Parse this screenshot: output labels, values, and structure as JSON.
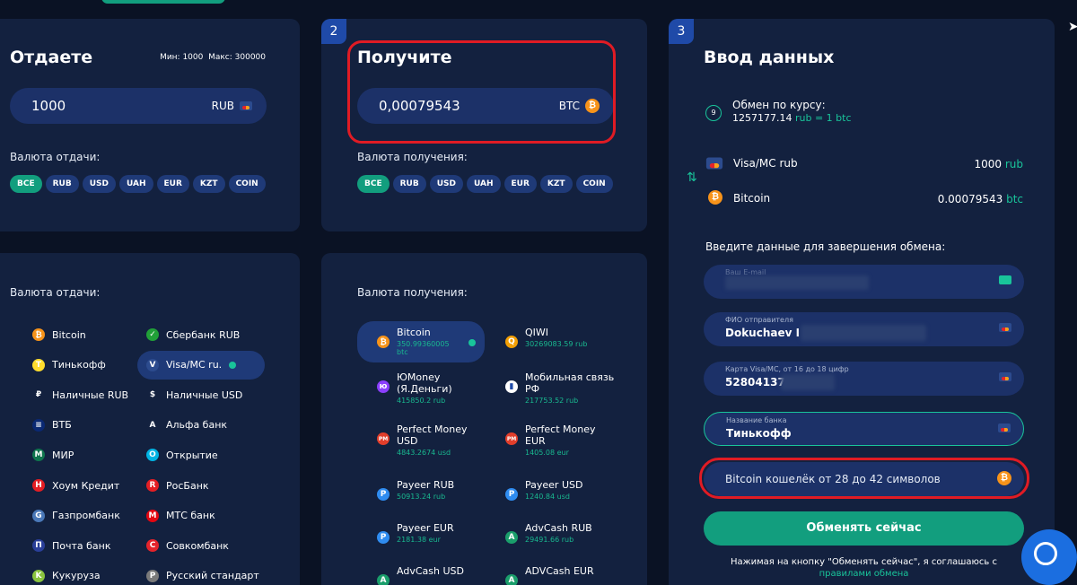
{
  "give": {
    "title": "Отдаете",
    "limits": "Мин: 1000  Макс: 300000",
    "amount": "1000",
    "currency": "RUB",
    "chips_label": "Валюта отдачи:",
    "chips": [
      "ВСЕ",
      "RUB",
      "USD",
      "UAH",
      "EUR",
      "KZT",
      "COIN"
    ],
    "list_label": "Валюта отдачи:",
    "list": [
      {
        "name": "Bitcoin",
        "color": "#f7931a",
        "glyph": "₿"
      },
      {
        "name": "Сбербанк RUB",
        "color": "#21a038",
        "glyph": "✓"
      },
      {
        "name": "Тинькофф",
        "color": "#ffdd2d",
        "glyph": "T"
      },
      {
        "name": "Visa/MC ru.",
        "color": "#2c4b8e",
        "glyph": "V"
      },
      {
        "name": "Наличные RUB",
        "color": "transparent",
        "glyph": "₽"
      },
      {
        "name": "Наличные USD",
        "color": "transparent",
        "glyph": "$"
      },
      {
        "name": "ВТБ",
        "color": "#0a2973",
        "glyph": "≡"
      },
      {
        "name": "Альфа банк",
        "color": "transparent",
        "glyph": "A"
      },
      {
        "name": "МИР",
        "color": "#0f754e",
        "glyph": "M"
      },
      {
        "name": "Открытие",
        "color": "#00b3e3",
        "glyph": "O"
      },
      {
        "name": "Хоум Кредит",
        "color": "#e31e24",
        "glyph": "H"
      },
      {
        "name": "РосБанк",
        "color": "#e31e24",
        "glyph": "R"
      },
      {
        "name": "Газпромбанк",
        "color": "#4a78b8",
        "glyph": "G"
      },
      {
        "name": "МТС банк",
        "color": "#e30611",
        "glyph": "M"
      },
      {
        "name": "Почта банк",
        "color": "#2a3f99",
        "glyph": "П"
      },
      {
        "name": "Совкомбанк",
        "color": "#e4232b",
        "glyph": "C"
      },
      {
        "name": "Кукуруза",
        "color": "#8ac43f",
        "glyph": "K"
      },
      {
        "name": "Русский стандарт",
        "color": "#7a7a7a",
        "glyph": "Р"
      }
    ]
  },
  "receive": {
    "step": "2",
    "title": "Получите",
    "amount": "0,00079543",
    "currency": "BTC",
    "chips_label": "Валюта получения:",
    "chips": [
      "ВСЕ",
      "RUB",
      "USD",
      "UAH",
      "EUR",
      "KZT",
      "COIN"
    ],
    "list_label": "Валюта получения:",
    "list": [
      {
        "name": "Bitcoin",
        "reserve": "350.99360005 btc",
        "color": "#f7931a",
        "glyph": "₿"
      },
      {
        "name": "QIWI",
        "reserve": "30269083.59 rub",
        "color": "#f29f05",
        "glyph": "Q"
      },
      {
        "name": "ЮMoney\n(Я.Деньги)",
        "reserve": "415850.2 rub",
        "color": "#8b3ffd",
        "glyph": "ю"
      },
      {
        "name": "Мобильная связь\nРФ",
        "reserve": "217753.52 rub",
        "color": "#ffffff",
        "glyph": "▮"
      },
      {
        "name": "Perfect Money\nUSD",
        "reserve": "4843.2674 usd",
        "color": "#e23e2b",
        "glyph": "PM"
      },
      {
        "name": "Perfect Money\nEUR",
        "reserve": "1405.08 eur",
        "color": "#e23e2b",
        "glyph": "PM"
      },
      {
        "name": "Payeer RUB",
        "reserve": "50913.24 rub",
        "color": "#2f8cf0",
        "glyph": "P"
      },
      {
        "name": "Payeer USD",
        "reserve": "1240.84 usd",
        "color": "#2f8cf0",
        "glyph": "P"
      },
      {
        "name": "Payeer EUR",
        "reserve": "2181.38 eur",
        "color": "#2f8cf0",
        "glyph": "P"
      },
      {
        "name": "AdvCash RUB",
        "reserve": "29491.66 rub",
        "color": "#1a9e6b",
        "glyph": "A"
      },
      {
        "name": "AdvCash USD",
        "reserve": "",
        "color": "#1a9e6b",
        "glyph": "A"
      },
      {
        "name": "ADVCash EUR",
        "reserve": "",
        "color": "#1a9e6b",
        "glyph": "A"
      }
    ]
  },
  "details": {
    "step": "3",
    "title": "Ввод данных",
    "rate_label": "Обмен по курсу:",
    "rate_value": "1257177.14",
    "rate_suffix": "rub = 1 btc",
    "from_name": "Visa/MC rub",
    "from_amount": "1000",
    "from_unit": "rub",
    "to_name": "Bitcoin",
    "to_amount": "0.00079543",
    "to_unit": "btc",
    "prompt": "Введите данные для завершения обмена:",
    "email_label": "Ваш E-mail",
    "sender_label": "ФИО отправителя",
    "sender_value": "Dokuchaev I",
    "card_label": "Карта Visa/MC, от 16 до 18 цифр",
    "card_value": "52804137",
    "bank_label": "Название банка",
    "bank_value": "Тинькофф",
    "wallet_placeholder": "Bitcoin кошелёк от 28 до 42 символов",
    "submit": "Обменять сейчас",
    "agree_text": "Нажимая на кнопку \"Обменять сейчас\", я соглашаюсь с",
    "agree_link": "правилами обмена"
  },
  "step1": "",
  "colors": {
    "accent": "#129e7e",
    "panel": "#13213f",
    "field": "#1c3168",
    "ring": "#e01b24"
  }
}
